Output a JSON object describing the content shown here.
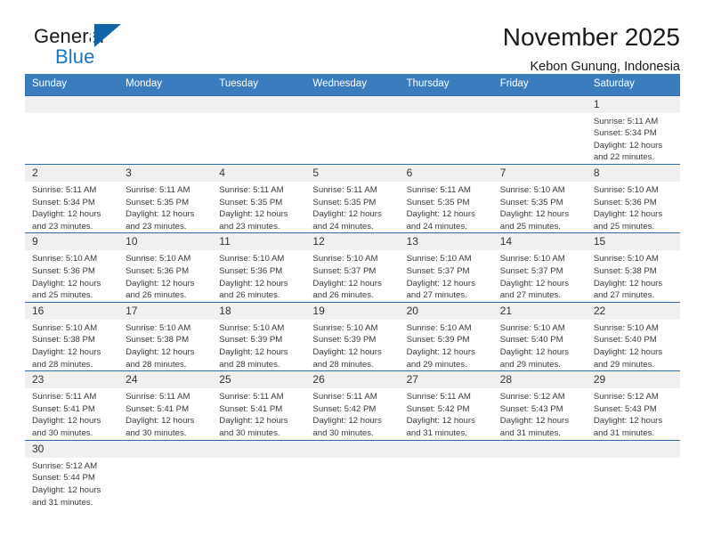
{
  "brand": {
    "name_top": "General",
    "name_bottom": "Blue",
    "triangle_color": "#1263a8",
    "blue_color": "#1878c8"
  },
  "header": {
    "title": "November 2025",
    "subtitle": "Kebon Gunung, Indonesia",
    "header_bg": "#3b7cbf",
    "row_border": "#2f6ba8",
    "daynum_bg": "#f0f0f0"
  },
  "weekdays": [
    "Sunday",
    "Monday",
    "Tuesday",
    "Wednesday",
    "Thursday",
    "Friday",
    "Saturday"
  ],
  "weeks": [
    [
      {
        "day": "",
        "empty": true
      },
      {
        "day": "",
        "empty": true
      },
      {
        "day": "",
        "empty": true
      },
      {
        "day": "",
        "empty": true
      },
      {
        "day": "",
        "empty": true
      },
      {
        "day": "",
        "empty": true
      },
      {
        "day": "1",
        "sunrise": "Sunrise: 5:11 AM",
        "sunset": "Sunset: 5:34 PM",
        "daylight": "Daylight: 12 hours and 22 minutes."
      }
    ],
    [
      {
        "day": "2",
        "sunrise": "Sunrise: 5:11 AM",
        "sunset": "Sunset: 5:34 PM",
        "daylight": "Daylight: 12 hours and 23 minutes."
      },
      {
        "day": "3",
        "sunrise": "Sunrise: 5:11 AM",
        "sunset": "Sunset: 5:35 PM",
        "daylight": "Daylight: 12 hours and 23 minutes."
      },
      {
        "day": "4",
        "sunrise": "Sunrise: 5:11 AM",
        "sunset": "Sunset: 5:35 PM",
        "daylight": "Daylight: 12 hours and 23 minutes."
      },
      {
        "day": "5",
        "sunrise": "Sunrise: 5:11 AM",
        "sunset": "Sunset: 5:35 PM",
        "daylight": "Daylight: 12 hours and 24 minutes."
      },
      {
        "day": "6",
        "sunrise": "Sunrise: 5:11 AM",
        "sunset": "Sunset: 5:35 PM",
        "daylight": "Daylight: 12 hours and 24 minutes."
      },
      {
        "day": "7",
        "sunrise": "Sunrise: 5:10 AM",
        "sunset": "Sunset: 5:35 PM",
        "daylight": "Daylight: 12 hours and 25 minutes."
      },
      {
        "day": "8",
        "sunrise": "Sunrise: 5:10 AM",
        "sunset": "Sunset: 5:36 PM",
        "daylight": "Daylight: 12 hours and 25 minutes."
      }
    ],
    [
      {
        "day": "9",
        "sunrise": "Sunrise: 5:10 AM",
        "sunset": "Sunset: 5:36 PM",
        "daylight": "Daylight: 12 hours and 25 minutes."
      },
      {
        "day": "10",
        "sunrise": "Sunrise: 5:10 AM",
        "sunset": "Sunset: 5:36 PM",
        "daylight": "Daylight: 12 hours and 26 minutes."
      },
      {
        "day": "11",
        "sunrise": "Sunrise: 5:10 AM",
        "sunset": "Sunset: 5:36 PM",
        "daylight": "Daylight: 12 hours and 26 minutes."
      },
      {
        "day": "12",
        "sunrise": "Sunrise: 5:10 AM",
        "sunset": "Sunset: 5:37 PM",
        "daylight": "Daylight: 12 hours and 26 minutes."
      },
      {
        "day": "13",
        "sunrise": "Sunrise: 5:10 AM",
        "sunset": "Sunset: 5:37 PM",
        "daylight": "Daylight: 12 hours and 27 minutes."
      },
      {
        "day": "14",
        "sunrise": "Sunrise: 5:10 AM",
        "sunset": "Sunset: 5:37 PM",
        "daylight": "Daylight: 12 hours and 27 minutes."
      },
      {
        "day": "15",
        "sunrise": "Sunrise: 5:10 AM",
        "sunset": "Sunset: 5:38 PM",
        "daylight": "Daylight: 12 hours and 27 minutes."
      }
    ],
    [
      {
        "day": "16",
        "sunrise": "Sunrise: 5:10 AM",
        "sunset": "Sunset: 5:38 PM",
        "daylight": "Daylight: 12 hours and 28 minutes."
      },
      {
        "day": "17",
        "sunrise": "Sunrise: 5:10 AM",
        "sunset": "Sunset: 5:38 PM",
        "daylight": "Daylight: 12 hours and 28 minutes."
      },
      {
        "day": "18",
        "sunrise": "Sunrise: 5:10 AM",
        "sunset": "Sunset: 5:39 PM",
        "daylight": "Daylight: 12 hours and 28 minutes."
      },
      {
        "day": "19",
        "sunrise": "Sunrise: 5:10 AM",
        "sunset": "Sunset: 5:39 PM",
        "daylight": "Daylight: 12 hours and 28 minutes."
      },
      {
        "day": "20",
        "sunrise": "Sunrise: 5:10 AM",
        "sunset": "Sunset: 5:39 PM",
        "daylight": "Daylight: 12 hours and 29 minutes."
      },
      {
        "day": "21",
        "sunrise": "Sunrise: 5:10 AM",
        "sunset": "Sunset: 5:40 PM",
        "daylight": "Daylight: 12 hours and 29 minutes."
      },
      {
        "day": "22",
        "sunrise": "Sunrise: 5:10 AM",
        "sunset": "Sunset: 5:40 PM",
        "daylight": "Daylight: 12 hours and 29 minutes."
      }
    ],
    [
      {
        "day": "23",
        "sunrise": "Sunrise: 5:11 AM",
        "sunset": "Sunset: 5:41 PM",
        "daylight": "Daylight: 12 hours and 30 minutes."
      },
      {
        "day": "24",
        "sunrise": "Sunrise: 5:11 AM",
        "sunset": "Sunset: 5:41 PM",
        "daylight": "Daylight: 12 hours and 30 minutes."
      },
      {
        "day": "25",
        "sunrise": "Sunrise: 5:11 AM",
        "sunset": "Sunset: 5:41 PM",
        "daylight": "Daylight: 12 hours and 30 minutes."
      },
      {
        "day": "26",
        "sunrise": "Sunrise: 5:11 AM",
        "sunset": "Sunset: 5:42 PM",
        "daylight": "Daylight: 12 hours and 30 minutes."
      },
      {
        "day": "27",
        "sunrise": "Sunrise: 5:11 AM",
        "sunset": "Sunset: 5:42 PM",
        "daylight": "Daylight: 12 hours and 31 minutes."
      },
      {
        "day": "28",
        "sunrise": "Sunrise: 5:12 AM",
        "sunset": "Sunset: 5:43 PM",
        "daylight": "Daylight: 12 hours and 31 minutes."
      },
      {
        "day": "29",
        "sunrise": "Sunrise: 5:12 AM",
        "sunset": "Sunset: 5:43 PM",
        "daylight": "Daylight: 12 hours and 31 minutes."
      }
    ],
    [
      {
        "day": "30",
        "sunrise": "Sunrise: 5:12 AM",
        "sunset": "Sunset: 5:44 PM",
        "daylight": "Daylight: 12 hours and 31 minutes."
      },
      {
        "day": "",
        "empty": true
      },
      {
        "day": "",
        "empty": true
      },
      {
        "day": "",
        "empty": true
      },
      {
        "day": "",
        "empty": true
      },
      {
        "day": "",
        "empty": true
      },
      {
        "day": "",
        "empty": true
      }
    ]
  ]
}
